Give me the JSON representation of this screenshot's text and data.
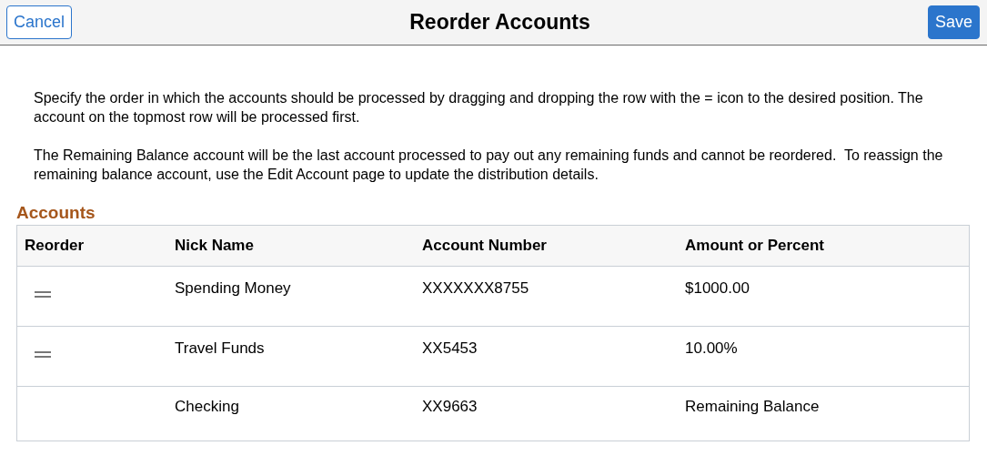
{
  "header": {
    "title": "Reorder Accounts",
    "cancel": "Cancel",
    "save": "Save"
  },
  "instructions": [
    "Specify the order in which the accounts should be processed by dragging and dropping the row with the = icon to the desired position. The account on the topmost row will be processed first.",
    "The Remaining Balance account will be the last account processed to pay out any remaining funds and cannot be reordered.  To reassign the remaining balance account, use the Edit Account page to update the distribution details."
  ],
  "accounts": {
    "title": "Accounts",
    "columns": [
      "Reorder",
      "Nick Name",
      "Account Number",
      "Amount or Percent"
    ],
    "rows": [
      {
        "draggable": true,
        "nick_name": "Spending Money",
        "account_number": "XXXXXXX8755",
        "amount": "$1000.00"
      },
      {
        "draggable": true,
        "nick_name": "Travel Funds",
        "account_number": "XX5453",
        "amount": "10.00%"
      },
      {
        "draggable": false,
        "nick_name": "Checking",
        "account_number": "XX9663",
        "amount": "Remaining Balance"
      }
    ]
  }
}
